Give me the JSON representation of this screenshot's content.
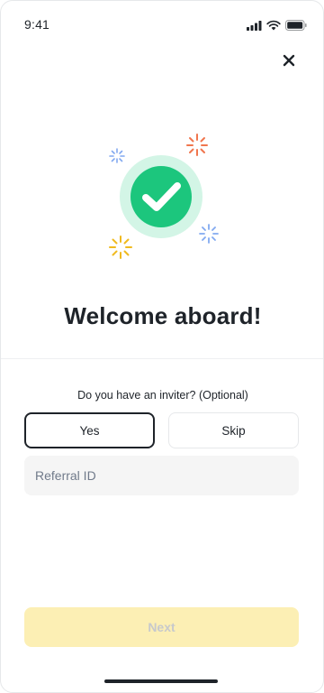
{
  "status_bar": {
    "time": "9:41",
    "icons": [
      "cellular-signal-icon",
      "wifi-icon",
      "battery-icon"
    ]
  },
  "header": {
    "close_icon": "close-icon"
  },
  "illustration": {
    "icon": "check-circle-icon",
    "colors": {
      "check_circle": "#1CC67D",
      "check_halo": "#D3F5E6",
      "sparkle_orange": "#F0764E",
      "sparkle_blue": "#82A9F0",
      "sparkle_yellow": "#F0BA1F"
    }
  },
  "title": "Welcome aboard!",
  "inviter": {
    "question": "Do you have an inviter? (Optional)",
    "yes_label": "Yes",
    "skip_label": "Skip",
    "selected": "Yes",
    "referral_placeholder": "Referral ID",
    "referral_value": ""
  },
  "footer": {
    "next_label": "Next",
    "next_color": "#FCEFB4"
  }
}
